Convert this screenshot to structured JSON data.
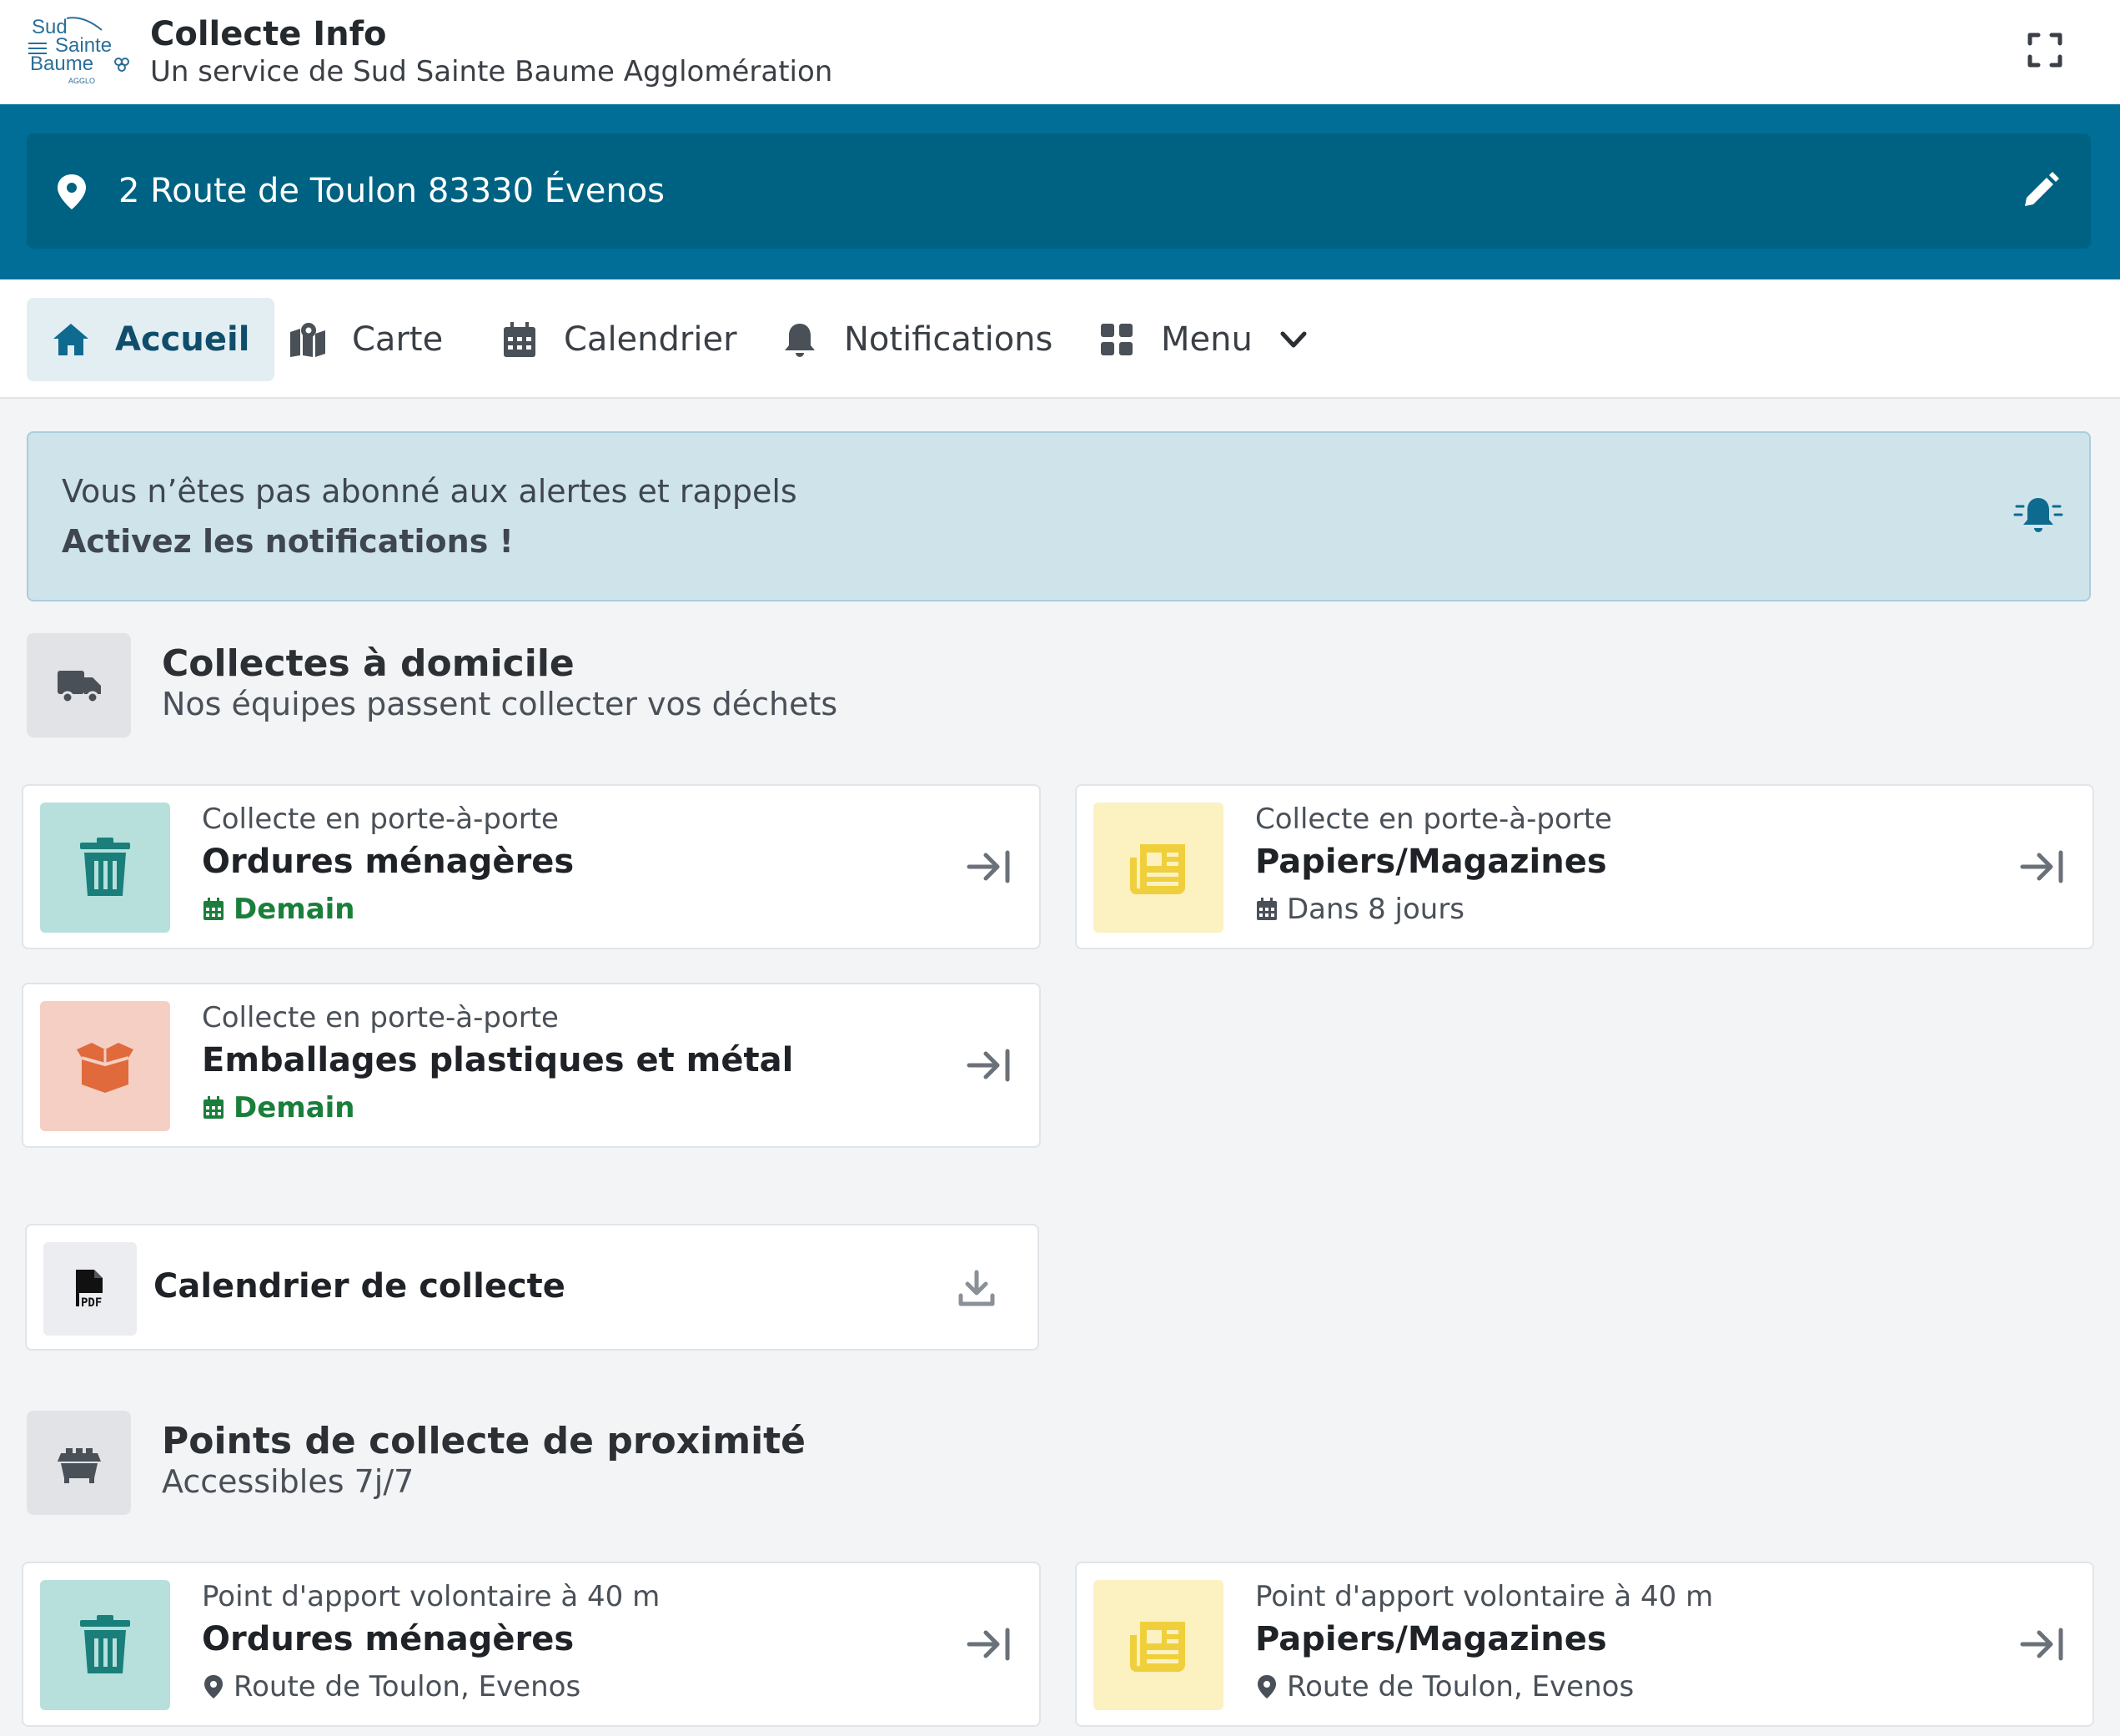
{
  "header": {
    "logo_text": [
      "Sud",
      "Sainte",
      "Baume",
      "AGGLO"
    ],
    "title": "Collecte Info",
    "subtitle": "Un service de Sud Sainte Baume Agglomération"
  },
  "address": {
    "value": "2 Route de Toulon 83330 Évenos"
  },
  "nav": {
    "items": [
      {
        "label": "Accueil",
        "icon": "home-icon",
        "active": true
      },
      {
        "label": "Carte",
        "icon": "map-icon"
      },
      {
        "label": "Calendrier",
        "icon": "calendar-icon"
      },
      {
        "label": "Notifications",
        "icon": "bell-icon"
      },
      {
        "label": "Menu",
        "icon": "grid-icon"
      }
    ]
  },
  "banner": {
    "line1": "Vous n’êtes pas abonné aux alertes et rappels",
    "line2": "Activez les notifications !"
  },
  "home_collections": {
    "title": "Collectes à domicile",
    "subtitle": "Nos équipes passent collecter vos déchets",
    "cards": [
      {
        "kicker": "Collecte en porte-à-porte",
        "title": "Ordures ménagères",
        "meta": "Demain",
        "icon": "trash-icon",
        "color": "#1a7f7a"
      },
      {
        "kicker": "Collecte en porte-à-porte",
        "title": "Papiers/Magazines",
        "meta": "Dans 8 jours",
        "icon": "newspaper-icon",
        "color": "#f0cf3c"
      },
      {
        "kicker": "Collecte en porte-à-porte",
        "title": "Emballages plastiques et métal",
        "meta": "Demain",
        "icon": "box-icon",
        "color": "#e06a3b"
      }
    ]
  },
  "calendar_pdf": {
    "title": "Calendrier de collecte",
    "pdf_label": "PDF"
  },
  "proximity": {
    "title": "Points de collecte de proximité",
    "subtitle": "Accessibles 7j/7",
    "cards": [
      {
        "kicker": "Point d'apport volontaire à 40 m",
        "title": "Ordures ménagères",
        "meta": "Route de Toulon, Evenos",
        "icon": "trash-icon"
      },
      {
        "kicker": "Point d'apport volontaire à 40 m",
        "title": "Papiers/Magazines",
        "meta": "Route de Toulon, Evenos",
        "icon": "newspaper-icon"
      }
    ]
  },
  "colors": {
    "brand": "#006e96",
    "brand_dark": "#006282",
    "green": "#1a7f3b"
  }
}
